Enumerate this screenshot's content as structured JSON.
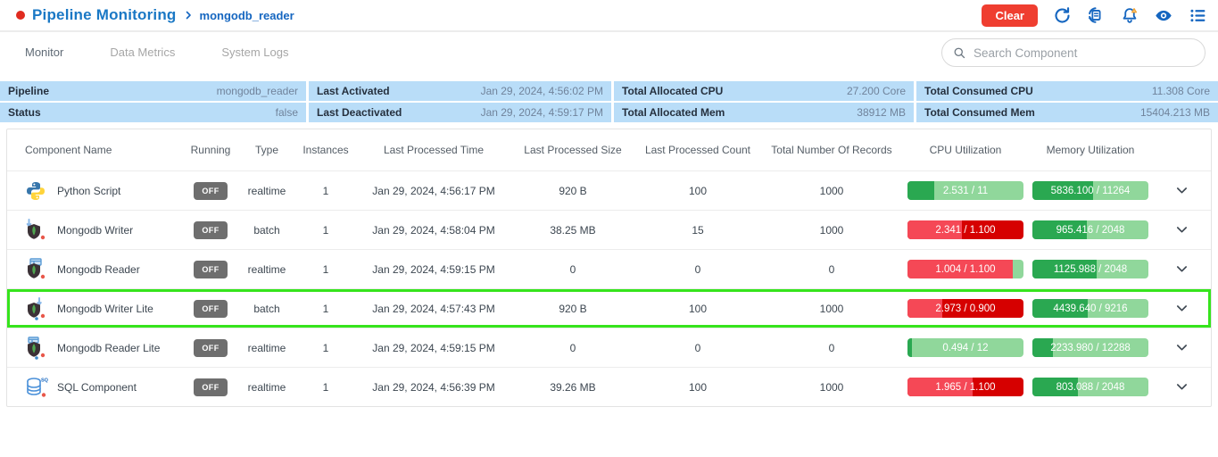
{
  "colors": {
    "brand_blue": "#1a78c5",
    "link_blue": "#1566c0",
    "danger_red": "#ef3e30",
    "record_dot_red": "#e02b20",
    "summary_bg": "#b9ddf8",
    "badge_gray": "#6e6e6e",
    "bar_green_dark": "#2aa851",
    "bar_green_light": "#90d79b",
    "bar_red_light": "#f54856",
    "bar_red_dark": "#d60000",
    "highlight_green": "#36e41c"
  },
  "header": {
    "title": "Pipeline Monitoring",
    "breadcrumb": "mongodb_reader",
    "clear_label": "Clear",
    "icons": [
      "refresh-icon",
      "history-icon",
      "notifications-icon",
      "visibility-icon",
      "list-view-icon"
    ]
  },
  "tabs": [
    {
      "label": "Monitor",
      "active": true
    },
    {
      "label": "Data Metrics",
      "active": false
    },
    {
      "label": "System Logs",
      "active": false
    }
  ],
  "search": {
    "placeholder": "Search Component"
  },
  "summary": {
    "rows": [
      [
        {
          "label": "Pipeline",
          "value": "mongodb_reader"
        },
        {
          "label": "Last Activated",
          "value": "Jan 29, 2024, 4:56:02 PM"
        },
        {
          "label": "Total Allocated CPU",
          "value": "27.200 Core"
        },
        {
          "label": "Total Consumed CPU",
          "value": "11.308 Core"
        }
      ],
      [
        {
          "label": "Status",
          "value": "false"
        },
        {
          "label": "Last Deactivated",
          "value": "Jan 29, 2024, 4:59:17 PM"
        },
        {
          "label": "Total Allocated Mem",
          "value": "38912 MB"
        },
        {
          "label": "Total Consumed Mem",
          "value": "15404.213 MB"
        }
      ]
    ]
  },
  "table": {
    "columns": [
      "Component Name",
      "Running",
      "Type",
      "Instances",
      "Last Processed Time",
      "Last Processed Size",
      "Last Processed Count",
      "Total Number Of Records",
      "CPU Utilization",
      "Memory Utilization"
    ],
    "rows": [
      {
        "name": "Python Script",
        "icon": "python-icon",
        "running": "OFF",
        "type": "realtime",
        "instances": "1",
        "last_processed_time": "Jan 29, 2024, 4:56:17 PM",
        "last_processed_size": "920 B",
        "last_processed_count": "100",
        "total_records": "1000",
        "cpu": {
          "text": "2.531 / 11",
          "fill_pct": 23,
          "style": "green"
        },
        "mem": {
          "text": "5836.100 / 11264",
          "fill_pct": 52,
          "style": "green"
        },
        "highlighted": false
      },
      {
        "name": "Mongodb Writer",
        "icon": "mongodb-writer-icon",
        "running": "OFF",
        "type": "batch",
        "instances": "1",
        "last_processed_time": "Jan 29, 2024, 4:58:04 PM",
        "last_processed_size": "38.25 MB",
        "last_processed_count": "15",
        "total_records": "1000",
        "cpu": {
          "text": "2.341 / 1.100",
          "fill_pct": 47,
          "style": "red-over"
        },
        "mem": {
          "text": "965.416 / 2048",
          "fill_pct": 47,
          "style": "green"
        },
        "highlighted": false
      },
      {
        "name": "Mongodb Reader",
        "icon": "mongodb-reader-icon",
        "running": "OFF",
        "type": "realtime",
        "instances": "1",
        "last_processed_time": "Jan 29, 2024, 4:59:15 PM",
        "last_processed_size": "0",
        "last_processed_count": "0",
        "total_records": "0",
        "cpu": {
          "text": "1.004 / 1.100",
          "fill_pct": 91,
          "style": "red-high"
        },
        "mem": {
          "text": "1125.988 / 2048",
          "fill_pct": 55,
          "style": "green"
        },
        "highlighted": false
      },
      {
        "name": "Mongodb Writer Lite",
        "icon": "mongodb-writer-lite-icon",
        "running": "OFF",
        "type": "batch",
        "instances": "1",
        "last_processed_time": "Jan 29, 2024, 4:57:43 PM",
        "last_processed_size": "920 B",
        "last_processed_count": "100",
        "total_records": "1000",
        "cpu": {
          "text": "2.973 / 0.900",
          "fill_pct": 30,
          "style": "red-over"
        },
        "mem": {
          "text": "4439.640 / 9216",
          "fill_pct": 48,
          "style": "green"
        },
        "highlighted": true
      },
      {
        "name": "Mongodb Reader Lite",
        "icon": "mongodb-reader-lite-icon",
        "running": "OFF",
        "type": "realtime",
        "instances": "1",
        "last_processed_time": "Jan 29, 2024, 4:59:15 PM",
        "last_processed_size": "0",
        "last_processed_count": "0",
        "total_records": "0",
        "cpu": {
          "text": "0.494 / 12",
          "fill_pct": 4,
          "style": "green"
        },
        "mem": {
          "text": "2233.980 / 12288",
          "fill_pct": 18,
          "style": "green"
        },
        "highlighted": false
      },
      {
        "name": "SQL Component",
        "icon": "sql-icon",
        "running": "OFF",
        "type": "realtime",
        "instances": "1",
        "last_processed_time": "Jan 29, 2024, 4:56:39 PM",
        "last_processed_size": "39.26 MB",
        "last_processed_count": "100",
        "total_records": "1000",
        "cpu": {
          "text": "1.965 / 1.100",
          "fill_pct": 56,
          "style": "red-over"
        },
        "mem": {
          "text": "803.088 / 2048",
          "fill_pct": 39,
          "style": "green"
        },
        "highlighted": false
      }
    ]
  }
}
